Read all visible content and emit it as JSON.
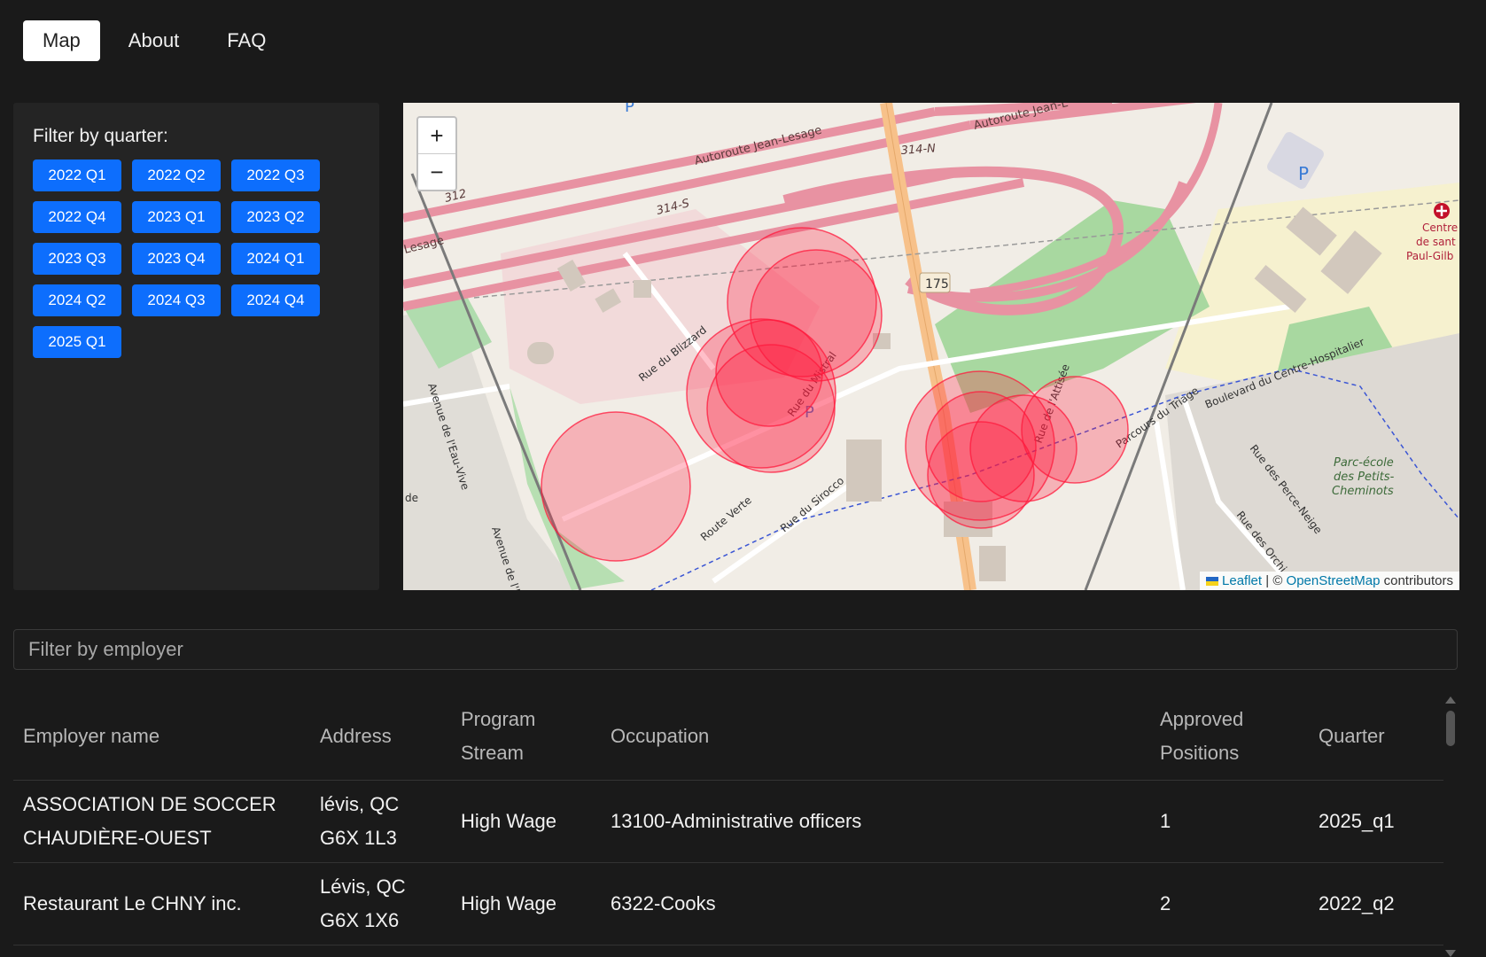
{
  "nav": {
    "items": [
      {
        "label": "Map",
        "active": true
      },
      {
        "label": "About",
        "active": false
      },
      {
        "label": "FAQ",
        "active": false
      }
    ]
  },
  "filter": {
    "title": "Filter by quarter:",
    "quarters": [
      "2022 Q1",
      "2022 Q2",
      "2022 Q3",
      "2022 Q4",
      "2023 Q1",
      "2023 Q2",
      "2023 Q3",
      "2023 Q4",
      "2024 Q1",
      "2024 Q2",
      "2024 Q3",
      "2024 Q4",
      "2025 Q1"
    ]
  },
  "map": {
    "zoom_in": "+",
    "zoom_out": "−",
    "attribution": {
      "leaflet": "Leaflet",
      "separator": "| ©",
      "osm": "OpenStreetMap",
      "suffix": "contributors"
    },
    "labels": {
      "autoroute_1": "Autoroute Jean-Lesage",
      "autoroute_2": "Autoroute Jean-L",
      "lesage": "Lesage",
      "r312": "312",
      "r314s": "314-S",
      "r314n": "314-N",
      "r175": "175",
      "rue_blizzard": "Rue du Blizzard",
      "rue_mistral": "Rue du Mistral",
      "rue_attisee": "Rue de l'Attisée",
      "route_verte": "Route Verte",
      "rue_sirocco": "Rue du Sirocco",
      "parcours": "Parcours du Triage",
      "boulevard": "Boulevard du Centre-Hospitalier",
      "av_eau_vive": "Avenue de l'Eau-Vive",
      "av_de": "Avenue de l'É",
      "rue_perce_neige": "Rue des Perce-Neige",
      "rue_orchi": "Rue des Orchi",
      "parc": [
        "Parc-école",
        "des Petits-",
        "Cheminots"
      ],
      "centre": [
        "Centre",
        "de sant",
        "Paul-Gilb"
      ],
      "parking": "P",
      "de": "de"
    },
    "marker_color": "#ff1a3c"
  },
  "search": {
    "placeholder": "Filter by employer",
    "value": ""
  },
  "table": {
    "headers": [
      "Employer name",
      "Address",
      "Program Stream",
      "Occupation",
      "Approved Positions",
      "Quarter"
    ],
    "rows": [
      [
        "ASSOCIATION DE SOCCER CHAUDIÈRE-OUEST",
        "lévis, QC G6X 1L3",
        "High Wage",
        "13100-Administrative officers",
        "1",
        "2025_q1"
      ],
      [
        "Restaurant Le CHNY inc.",
        "Lévis, QC G6X 1X6",
        "High Wage",
        "6322-Cooks",
        "2",
        "2022_q2"
      ]
    ]
  }
}
